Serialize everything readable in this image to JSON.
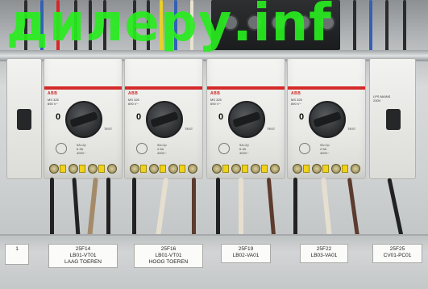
{
  "watermark": {
    "text": "дилеру.inf",
    "color": "#22e61a"
  },
  "breakers": [
    {
      "brand": "ABB",
      "model": "MS 325\n690 V~",
      "zero": "0",
      "test": "TEST",
      "spec": "9A=2p\n6.3A\n400V~"
    },
    {
      "brand": "ABB",
      "model": "MS 325\n690 V~",
      "zero": "0",
      "test": "TEST",
      "spec": "9A=2p\n2.5A\n400V~"
    },
    {
      "brand": "ABB",
      "model": "MS 325\n690 V~",
      "zero": "0",
      "test": "TEST",
      "spec": "9A=2p\n6.3A\n400V~"
    },
    {
      "brand": "ABB",
      "model": "MS 325\n690 V~",
      "zero": "0",
      "test": "TEST",
      "spec": "9A=2p\n2.5A\n400V~"
    }
  ],
  "right_mcb": {
    "label": "LPS MAINS\n230V"
  },
  "labels": [
    {
      "line1": "1",
      "line2": "",
      "line3": ""
    },
    {
      "line1": "25F14",
      "line2": "LB01-VT01",
      "line3": "LAAG TOEREN"
    },
    {
      "line1": "25F16",
      "line2": "LB01-VT01",
      "line3": "HOOG TOEREN"
    },
    {
      "line1": "25F19",
      "line2": "LB02-VA01",
      "line3": ""
    },
    {
      "line1": "25F22",
      "line2": "LB03-VA01",
      "line3": ""
    },
    {
      "line1": "25F25",
      "line2": "CV01-PC01",
      "line3": ""
    }
  ],
  "colors": {
    "abb_red": "#d42a2a",
    "label_bg": "#fbfbf9",
    "terminal_yellow": "#f0d21a"
  }
}
